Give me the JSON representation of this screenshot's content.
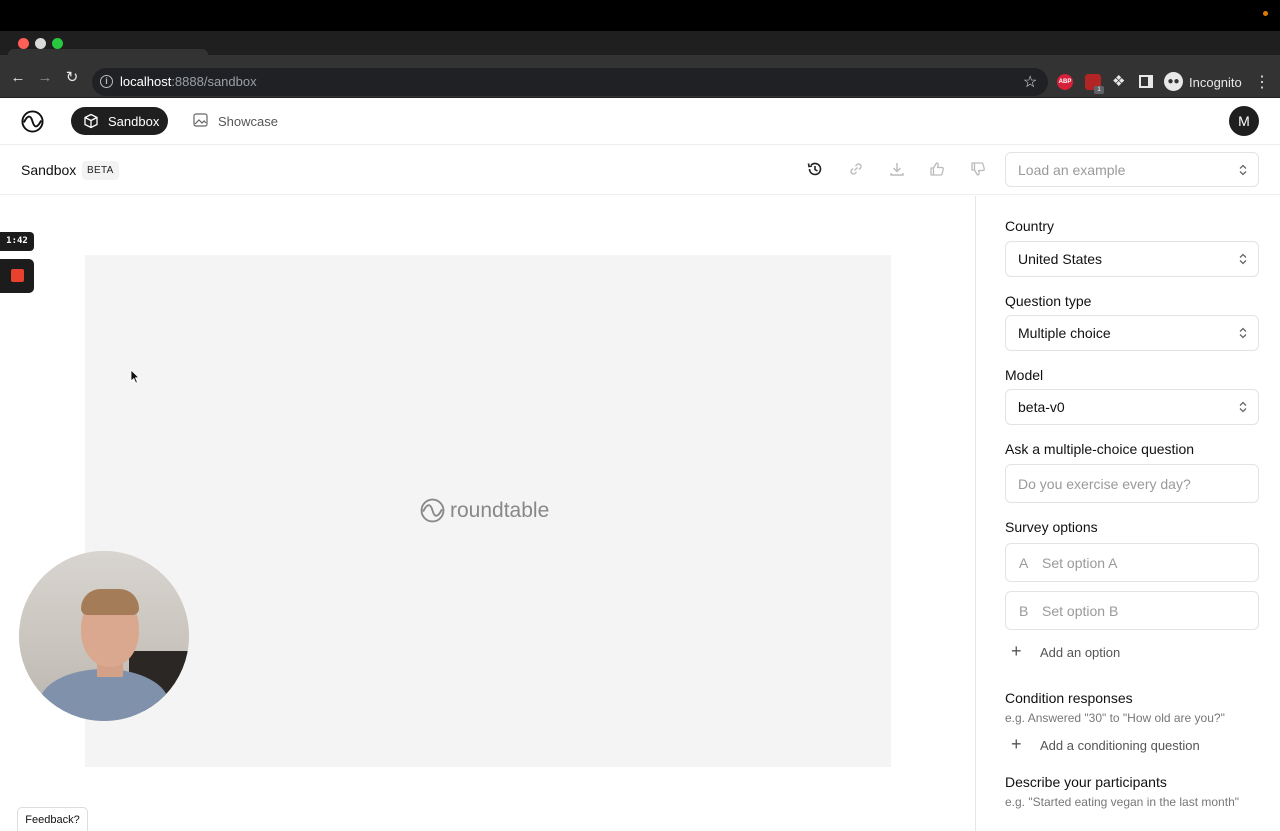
{
  "browser": {
    "url_host": "localhost",
    "url_path": ":8888/sandbox",
    "profile_label": "Incognito",
    "ext_abp": "ABP",
    "ext_badge": "1"
  },
  "nav": {
    "sandbox_label": "Sandbox",
    "showcase_label": "Showcase",
    "avatar_letter": "M"
  },
  "subheader": {
    "title": "Sandbox",
    "badge": "BETA",
    "example_placeholder": "Load an example"
  },
  "canvas": {
    "brand_name": "roundtable"
  },
  "recorder": {
    "timer": "1:42"
  },
  "feedback_label": "Feedback?",
  "form": {
    "country_label": "Country",
    "country_value": "United States",
    "question_type_label": "Question type",
    "question_type_value": "Multiple choice",
    "model_label": "Model",
    "model_value": "beta-v0",
    "question_label": "Ask a multiple-choice question",
    "question_placeholder": "Do you exercise every day?",
    "survey_options_label": "Survey options",
    "options": [
      {
        "letter": "A",
        "placeholder": "Set option A"
      },
      {
        "letter": "B",
        "placeholder": "Set option B"
      }
    ],
    "add_option_label": "Add an option",
    "condition_label": "Condition responses",
    "condition_hint": "e.g. Answered \"30\" to \"How old are you?\"",
    "add_condition_label": "Add a conditioning question",
    "participants_label": "Describe your participants",
    "participants_hint": "e.g. \"Started eating vegan in the last month\""
  },
  "colors": {
    "accent_dark": "#1f1f1f",
    "record_red": "#e8412e"
  }
}
